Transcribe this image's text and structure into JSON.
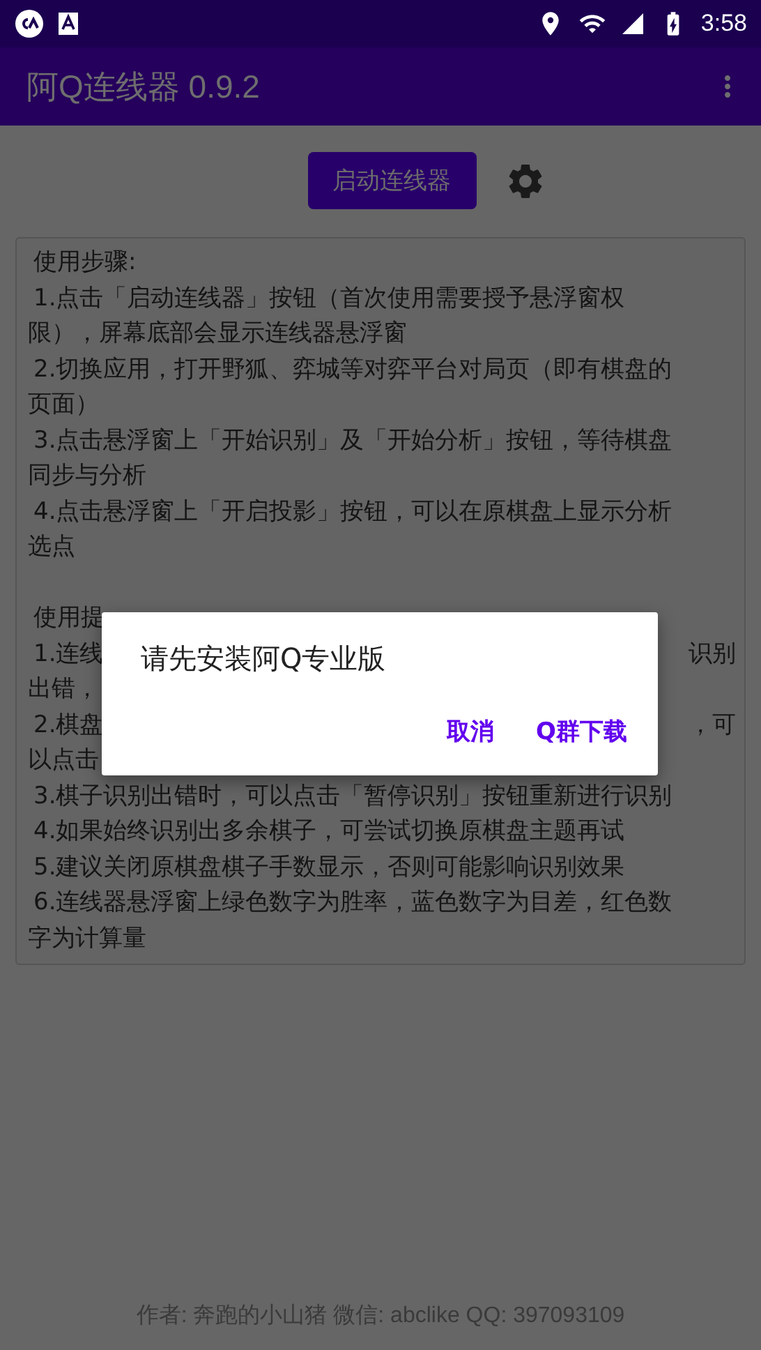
{
  "status_bar": {
    "time": "3:58"
  },
  "app_bar": {
    "title": "阿Q连线器 0.9.2"
  },
  "start_button": {
    "label": "启动连线器"
  },
  "instructions": {
    "lines": [
      {
        "kind": "start",
        "text": "使用步骤:"
      },
      {
        "kind": "start",
        "text": "1.点击「启动连线器」按钮（首次使用需要授予悬浮窗权"
      },
      {
        "kind": "wrap",
        "text": "限），屏幕底部会显示连线器悬浮窗"
      },
      {
        "kind": "start",
        "text": "2.切换应用，打开野狐、弈城等对弈平台对局页（即有棋盘的"
      },
      {
        "kind": "wrap",
        "text": "页面）"
      },
      {
        "kind": "start",
        "text": "3.点击悬浮窗上「开始识别」及「开始分析」按钮，等待棋盘"
      },
      {
        "kind": "wrap",
        "text": "同步与分析"
      },
      {
        "kind": "start",
        "text": "4.点击悬浮窗上「开启投影」按钮，可以在原棋盘上显示分析"
      },
      {
        "kind": "wrap",
        "text": "选点"
      },
      {
        "kind": "blank"
      },
      {
        "kind": "split_start",
        "left": "使用提"
      },
      {
        "kind": "split_start",
        "left": "1.连线",
        "right": "识别"
      },
      {
        "kind": "split_wrap",
        "left": "出错，"
      },
      {
        "kind": "split_start",
        "left": "2.棋盘",
        "right": "，可"
      },
      {
        "kind": "split_wrap",
        "left": "以点击"
      },
      {
        "kind": "start",
        "text": "3.棋子识别出错时，可以点击「暂停识别」按钮重新进行识别"
      },
      {
        "kind": "start",
        "text": "4.如果始终识别出多余棋子，可尝试切换原棋盘主题再试"
      },
      {
        "kind": "start",
        "text": "5.建议关闭原棋盘棋子手数显示，否则可能影响识别效果"
      },
      {
        "kind": "start",
        "text": "6.连线器悬浮窗上绿色数字为胜率，蓝色数字为目差，红色数"
      },
      {
        "kind": "wrap",
        "text": "字为计算量"
      }
    ]
  },
  "dialog": {
    "message": "请先安装阿Q专业版",
    "buttons": [
      "取消",
      "Q群下载"
    ]
  },
  "footer": "作者: 奔跑的小山猪 微信: abclike QQ: 397093109"
}
